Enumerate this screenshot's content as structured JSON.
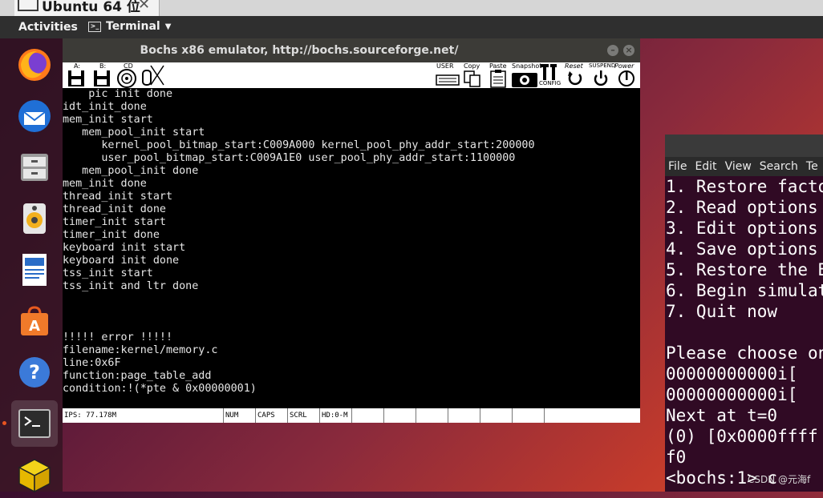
{
  "host_tab": {
    "title": "Ubuntu 64 位"
  },
  "topbar": {
    "activities": "Activities",
    "app_menu": "Terminal"
  },
  "bochs": {
    "title": "Bochs x86 emulator, http://bochs.sourceforge.net/",
    "toolbar": {
      "floppy_a": "A:",
      "floppy_b": "B:",
      "cdrom": "CD",
      "user": "USER",
      "copy": "Copy",
      "paste": "Paste",
      "snapshot": "Snapshot",
      "config": "CONFIG",
      "reset": "Reset",
      "suspend": "SUSPEND",
      "power": "Power"
    },
    "screen_lines": [
      "    pic init done",
      "idt_init_done",
      "mem_init start",
      "   mem_pool_init start",
      "      kernel_pool_bitmap_start:C009A000 kernel_pool_phy_addr_start:200000",
      "      user_pool_bitmap_start:C009A1E0 user_pool_phy_addr_start:1100000",
      "   mem_pool_init done",
      "mem_init done",
      "thread_init start",
      "thread_init done",
      "timer_init start",
      "timer_init done",
      "keyboard init start",
      "keyboard init done",
      "tss_init start",
      "tss_init and ltr done",
      "",
      "",
      "",
      "!!!!! error !!!!!",
      "filename:kernel/memory.c",
      "line:0x6F",
      "function:page_table_add",
      "condition:!(*pte & 0x00000001)"
    ],
    "status": {
      "ips": "IPS: 77.178M",
      "num": "NUM",
      "caps": "CAPS",
      "scrl": "SCRL",
      "hd": "HD:0-M"
    }
  },
  "terminal": {
    "menu": [
      "File",
      "Edit",
      "View",
      "Search",
      "Te"
    ],
    "lines": [
      "1. Restore facto",
      "2. Read options",
      "3. Edit options",
      "4. Save options",
      "5. Restore the B",
      "6. Begin simulat",
      "7. Quit now",
      "",
      "Please choose on",
      "00000000000i[",
      "00000000000i[",
      "Next at t=0",
      "(0) [0x0000ffff",
      "f0",
      "<bochs:1> c"
    ]
  },
  "watermark": "CSDN @元海f",
  "colors": {
    "ubuntu_orange": "#e95420",
    "terminal_bg": "#300a24",
    "topbar": "#2f2f2f"
  }
}
